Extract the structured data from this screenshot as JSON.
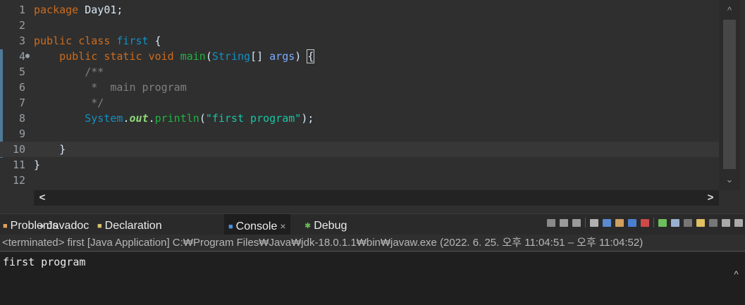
{
  "editor": {
    "lines": [
      {
        "n": "1",
        "current": false,
        "dot": false,
        "tokens": [
          {
            "t": "package",
            "c": "kw"
          },
          {
            "t": " Day01;",
            "c": ""
          }
        ]
      },
      {
        "n": "2",
        "current": false,
        "dot": false,
        "tokens": []
      },
      {
        "n": "3",
        "current": false,
        "dot": false,
        "tokens": [
          {
            "t": "public",
            "c": "kw"
          },
          {
            "t": " ",
            "c": ""
          },
          {
            "t": "class",
            "c": "kw"
          },
          {
            "t": " ",
            "c": ""
          },
          {
            "t": "first",
            "c": "cls"
          },
          {
            "t": " {",
            "c": ""
          }
        ]
      },
      {
        "n": "4",
        "current": false,
        "dot": true,
        "tokens": [
          {
            "t": "    ",
            "c": ""
          },
          {
            "t": "public",
            "c": "kw"
          },
          {
            "t": " ",
            "c": ""
          },
          {
            "t": "static",
            "c": "kw"
          },
          {
            "t": " ",
            "c": ""
          },
          {
            "t": "void",
            "c": "kw"
          },
          {
            "t": " ",
            "c": ""
          },
          {
            "t": "main",
            "c": "mth"
          },
          {
            "t": "(",
            "c": ""
          },
          {
            "t": "String",
            "c": "cls"
          },
          {
            "t": "[] ",
            "c": ""
          },
          {
            "t": "args",
            "c": "var"
          },
          {
            "t": ") ",
            "c": ""
          },
          {
            "t": "{",
            "c": "bracket"
          }
        ]
      },
      {
        "n": "5",
        "current": false,
        "dot": false,
        "tokens": [
          {
            "t": "        /**",
            "c": "cmt"
          }
        ]
      },
      {
        "n": "6",
        "current": false,
        "dot": false,
        "tokens": [
          {
            "t": "         *  main program",
            "c": "cmt"
          }
        ]
      },
      {
        "n": "7",
        "current": false,
        "dot": false,
        "tokens": [
          {
            "t": "         */",
            "c": "cmt"
          }
        ]
      },
      {
        "n": "8",
        "current": false,
        "dot": false,
        "tokens": [
          {
            "t": "        ",
            "c": ""
          },
          {
            "t": "System",
            "c": "sys"
          },
          {
            "t": ".",
            "c": ""
          },
          {
            "t": "out",
            "c": "fld"
          },
          {
            "t": ".",
            "c": ""
          },
          {
            "t": "println",
            "c": "mth"
          },
          {
            "t": "(",
            "c": ""
          },
          {
            "t": "\"first program\"",
            "c": "str"
          },
          {
            "t": ");",
            "c": ""
          }
        ]
      },
      {
        "n": "9",
        "current": false,
        "dot": false,
        "tokens": []
      },
      {
        "n": "10",
        "current": true,
        "dot": false,
        "tokens": [
          {
            "t": "    }",
            "c": ""
          }
        ]
      },
      {
        "n": "11",
        "current": false,
        "dot": false,
        "tokens": [
          {
            "t": "}",
            "c": ""
          }
        ]
      },
      {
        "n": "12",
        "current": false,
        "dot": false,
        "tokens": []
      }
    ],
    "scroll_up_glyph": "^",
    "scroll_down_glyph": "⌄",
    "scroll_left_glyph": "<",
    "scroll_right_glyph": ">"
  },
  "panel": {
    "tabs": [
      {
        "label": "Problems",
        "icon": "problems-icon",
        "glyph": "■",
        "color": "#e0a060",
        "active": false
      },
      {
        "label": "Javadoc",
        "icon": "javadoc-icon",
        "glyph": "●",
        "color": "#d0d0d0",
        "active": false
      },
      {
        "label": "Declaration",
        "icon": "declaration-icon",
        "glyph": "■",
        "color": "#d7c36a",
        "active": false
      },
      {
        "label": "Console",
        "icon": "console-icon",
        "glyph": "■",
        "color": "#4a90e2",
        "active": true
      },
      {
        "label": "Debug",
        "icon": "debug-icon",
        "glyph": "✱",
        "color": "#6cbf5a",
        "active": false
      }
    ],
    "close_glyph": "×",
    "toolbar_icons": [
      {
        "name": "terminate-icon",
        "color": "#8a8a8a"
      },
      {
        "name": "remove-launch-icon",
        "color": "#9a9a9a"
      },
      {
        "name": "remove-all-terminated-icon",
        "color": "#9a9a9a"
      },
      {
        "sep": true
      },
      {
        "name": "clear-console-icon",
        "color": "#b0b0b0"
      },
      {
        "name": "scroll-lock-icon",
        "color": "#5a8ad0"
      },
      {
        "name": "word-wrap-icon",
        "color": "#d0a060"
      },
      {
        "name": "show-on-stdout-icon",
        "color": "#4a7fd0"
      },
      {
        "name": "show-on-stderr-icon",
        "color": "#d04a4a"
      },
      {
        "sep": true
      },
      {
        "name": "pin-console-icon",
        "color": "#6cbf5a"
      },
      {
        "name": "display-console-icon",
        "color": "#9ab0d0"
      },
      {
        "name": "dropdown-icon",
        "color": "#777"
      },
      {
        "name": "open-console-icon",
        "color": "#e0c060"
      },
      {
        "name": "dropdown-icon",
        "color": "#777"
      },
      {
        "name": "minimize-icon",
        "color": "#aaa"
      },
      {
        "name": "maximize-icon",
        "color": "#aaa"
      }
    ],
    "status": "<terminated> first [Java Application] C:₩Program Files₩Java₩jdk-18.0.1.1₩bin₩javaw.exe  (2022. 6. 25. 오후 11:04:51 – 오후 11:04:52)"
  },
  "console": {
    "output": "first program",
    "scroll_up_glyph": "^"
  }
}
